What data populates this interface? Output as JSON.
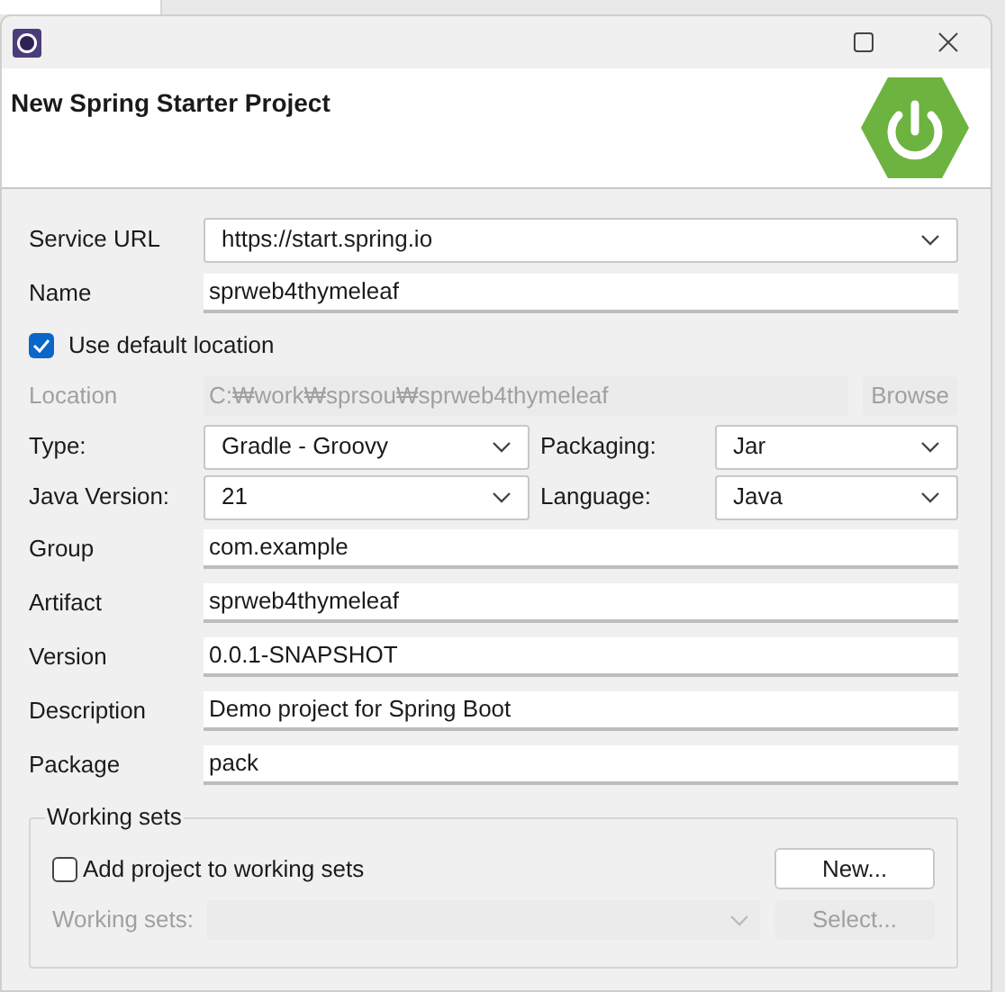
{
  "header": {
    "title": "New Spring Starter Project"
  },
  "rows": [
    {
      "kind": "combo",
      "label": "Service URL",
      "value": "https://start.spring.io"
    },
    {
      "kind": "text",
      "label": "Name",
      "value": "sprweb4thymeleaf"
    },
    {
      "kind": "checkbox",
      "label": "Use default location",
      "checked": true
    },
    {
      "kind": "location",
      "label": "Location",
      "value": "C:₩work₩sprsou₩sprweb4thymeleaf",
      "button": "Browse",
      "disabled": true
    },
    {
      "kind": "pair",
      "items": [
        {
          "label": "Type:",
          "value": "Gradle - Groovy"
        },
        {
          "label": "Packaging:",
          "value": "Jar"
        }
      ]
    },
    {
      "kind": "pair",
      "items": [
        {
          "label": "Java Version:",
          "value": "21"
        },
        {
          "label": "Language:",
          "value": "Java"
        }
      ]
    },
    {
      "kind": "text",
      "label": "Group",
      "value": "com.example"
    },
    {
      "kind": "text",
      "label": "Artifact",
      "value": "sprweb4thymeleaf"
    },
    {
      "kind": "text",
      "label": "Version",
      "value": "0.0.1-SNAPSHOT"
    },
    {
      "kind": "text",
      "label": "Description",
      "value": "Demo project for Spring Boot"
    },
    {
      "kind": "text",
      "label": "Package",
      "value": "pack"
    }
  ],
  "working_sets": {
    "title": "Working sets",
    "add": {
      "label": "Add project to working sets",
      "checked": false
    },
    "new_button": "New...",
    "field_label": "Working sets:",
    "select_button": "Select...",
    "disabled": true
  }
}
